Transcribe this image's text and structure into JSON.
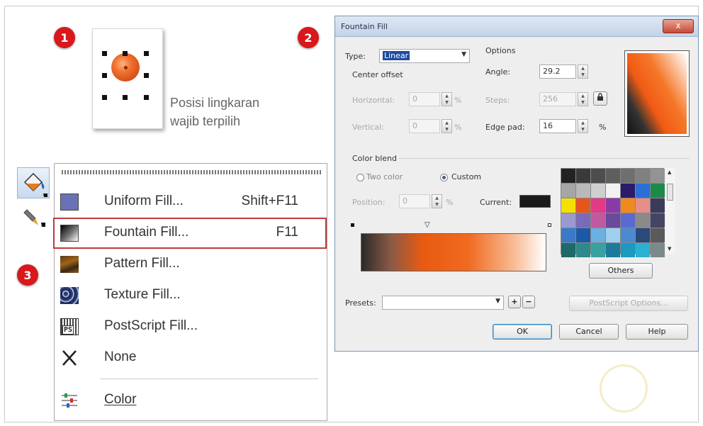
{
  "steps": {
    "one": "1",
    "two": "2",
    "three": "3"
  },
  "caption": {
    "line1": "Posisi lingkaran",
    "line2": "wajib terpilih"
  },
  "menu": {
    "items": [
      {
        "label": "Uniform Fill...",
        "shortcut": "Shift+F11",
        "icon": "uniform-fill-icon",
        "color": "#6a72b6"
      },
      {
        "label": "Fountain Fill...",
        "shortcut": "F11",
        "icon": "fountain-fill-icon"
      },
      {
        "label": "Pattern Fill...",
        "shortcut": "",
        "icon": "pattern-fill-icon"
      },
      {
        "label": "Texture Fill...",
        "shortcut": "",
        "icon": "texture-fill-icon"
      },
      {
        "label": "PostScript Fill...",
        "shortcut": "",
        "icon": "postscript-fill-icon"
      },
      {
        "label": "None",
        "shortcut": "",
        "icon": "none-icon"
      },
      {
        "label": "Color",
        "shortcut": "",
        "icon": "color-icon"
      }
    ],
    "highlight_color": "#c23a3a"
  },
  "dialog": {
    "title": "Fountain Fill",
    "close": "x",
    "type_label": "Type:",
    "type_value": "Linear",
    "center_offset_label": "Center offset",
    "horizontal_label": "Horizontal:",
    "horizontal_value": "0",
    "vertical_label": "Vertical:",
    "vertical_value": "0",
    "percent": "%",
    "options_label": "Options",
    "angle_label": "Angle:",
    "angle_value": "29.2",
    "steps_label": "Steps:",
    "steps_value": "256",
    "edge_pad_label": "Edge pad:",
    "edge_pad_value": "16",
    "color_blend_label": "Color blend",
    "two_color_label": "Two color",
    "custom_label": "Custom",
    "position_label": "Position:",
    "position_value": "0",
    "current_label": "Current:",
    "others_label": "Others",
    "presets_label": "Presets:",
    "postscript_options_label": "PostScript Options...",
    "ok_label": "OK",
    "cancel_label": "Cancel",
    "help_label": "Help",
    "palette": [
      "#222222",
      "#3a3a3a",
      "#4d4d4d",
      "#5e5e5e",
      "#6f6f6f",
      "#808080",
      "#939393",
      "#a6a6a6",
      "#b9b9b9",
      "#cfcfcf",
      "#f2f2f2",
      "#2c1b6b",
      "#2a6fd6",
      "#1e8a4a",
      "#f4e000",
      "#e8541e",
      "#e23a86",
      "#8a3aa8",
      "#f08a1e",
      "#e88e8a",
      "#3a3a5a",
      "#9a9ad0",
      "#7a6ab8",
      "#c05aa0",
      "#6a4a9a",
      "#5a6ad0",
      "#8a8a8a",
      "#444466",
      "#3a7ac8",
      "#1a5aa8",
      "#6ab0e0",
      "#9fd0f0",
      "#4a8acf",
      "#2a4a7a",
      "#5a5a5a",
      "#1e6a6a",
      "#2e8a8a",
      "#3aa0a0",
      "#1e7a9a",
      "#1a9ac0",
      "#2ab0d0",
      "#7a8a8a"
    ]
  }
}
